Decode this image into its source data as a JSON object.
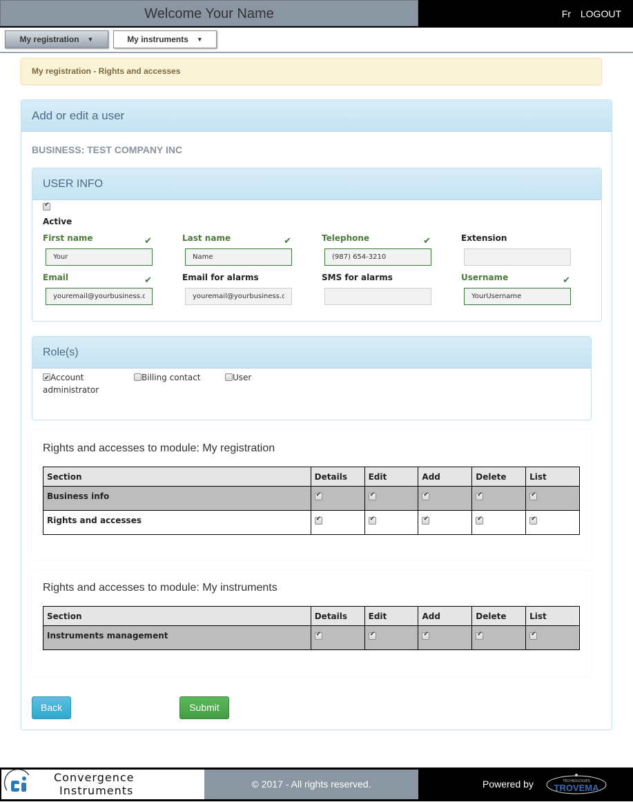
{
  "header": {
    "welcome": "Welcome  Your Name",
    "lang_link": "Fr",
    "logout_link": "LOGOUT"
  },
  "nav": {
    "items": [
      {
        "label": "My registration",
        "active": true
      },
      {
        "label": "My instruments",
        "active": false
      }
    ]
  },
  "breadcrumb": "My registration - Rights and accesses",
  "panel": {
    "title": "Add or edit a user",
    "business": "BUSINESS: TEST COMPANY INC"
  },
  "user_info": {
    "title": "USER INFO",
    "active": {
      "label": "Active",
      "checked": true
    },
    "fields": [
      {
        "label": "First name",
        "value": "Your",
        "valid": true
      },
      {
        "label": "Last name",
        "value": "Name",
        "valid": true
      },
      {
        "label": "Telephone",
        "value": "(987) 654-3210",
        "valid": true
      },
      {
        "label": "Extension",
        "value": "",
        "valid": false
      },
      {
        "label": "Email",
        "value": "youremail@yourbusiness.cc",
        "valid": true
      },
      {
        "label": "Email for alarms",
        "value": "youremail@yourbusiness.cc",
        "valid": false
      },
      {
        "label": "SMS for alarms",
        "value": "",
        "valid": false
      },
      {
        "label": "Username",
        "value": "YourUsername",
        "valid": true
      }
    ]
  },
  "roles": {
    "title": "Role(s)",
    "items": [
      {
        "label": "Account administrator",
        "line1": "Account",
        "line2": "administrator",
        "checked": true
      },
      {
        "label": "Billing contact",
        "checked": false
      },
      {
        "label": "User",
        "checked": false
      }
    ]
  },
  "rights": [
    {
      "title": "Rights and accesses to module: My registration",
      "columns": [
        "Section",
        "Details",
        "Edit",
        "Add",
        "Delete",
        "List"
      ],
      "rows": [
        {
          "section": "Business info",
          "details": true,
          "edit": true,
          "add": true,
          "delete": true,
          "list": true
        },
        {
          "section": "Rights and accesses",
          "details": true,
          "edit": true,
          "add": true,
          "delete": true,
          "list": true
        }
      ]
    },
    {
      "title": "Rights and accesses to module: My instruments",
      "columns": [
        "Section",
        "Details",
        "Edit",
        "Add",
        "Delete",
        "List"
      ],
      "rows": [
        {
          "section": "Instruments management",
          "details": true,
          "edit": true,
          "add": true,
          "delete": true,
          "list": true
        }
      ]
    }
  ],
  "buttons": {
    "back": "Back",
    "submit": "Submit"
  },
  "colors": {
    "back": "#5bc0de",
    "submit": "#5cb85c",
    "valid": "#3c763d"
  },
  "footer": {
    "logo_line1": "Convergence",
    "logo_line2": "Instruments",
    "copyright": "© 2017 - All rights reserved.",
    "powered_by": "Powered by",
    "partner_small": "TECHNOLOGIES",
    "partner_name": "TROVEMA"
  }
}
